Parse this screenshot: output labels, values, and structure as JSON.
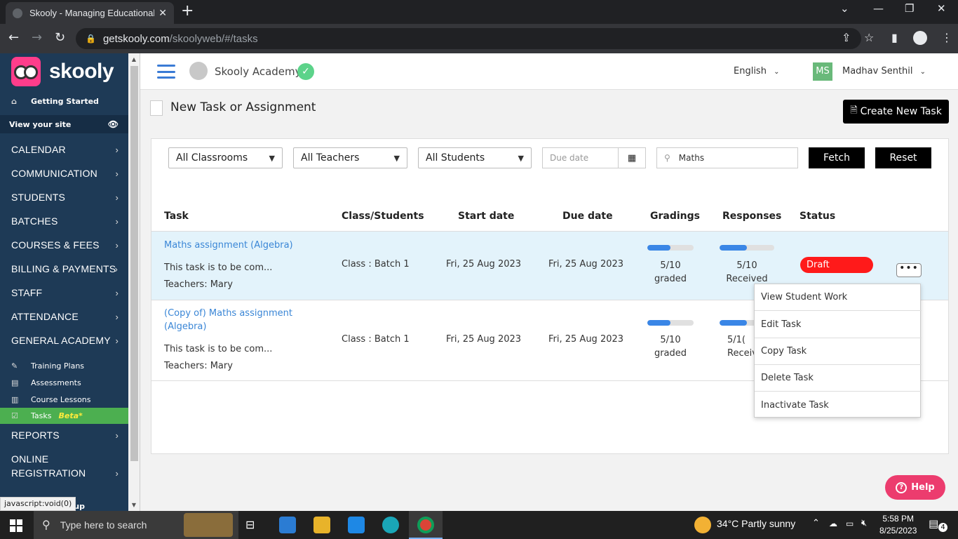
{
  "browser": {
    "tab_title": "Skooly - Managing Educational Ju",
    "url_domain": "getskooly.com",
    "url_path": "/skoolyweb/#/tasks"
  },
  "sidebar": {
    "brand": "skooly",
    "getting_started": "Getting Started",
    "view_site": "View your site",
    "menu": [
      "CALENDAR",
      "COMMUNICATION",
      "STUDENTS",
      "BATCHES",
      "COURSES & FEES",
      "BILLING & PAYMENTS",
      "STAFF",
      "ATTENDANCE",
      "GENERAL ACADEMY"
    ],
    "academy_items": [
      {
        "label": "Training Plans",
        "icon": "training-icon"
      },
      {
        "label": "Assessments",
        "icon": "assessment-icon"
      },
      {
        "label": "Course Lessons",
        "icon": "lessons-icon"
      },
      {
        "label": "Tasks",
        "icon": "tasks-icon",
        "badge": "Beta*"
      }
    ],
    "reports": "REPORTS",
    "online_registration_1": "ONLINE",
    "online_registration_2": "REGISTRATION",
    "status_text": "javascript:void(0)",
    "cut_text": "tup"
  },
  "header": {
    "school": "Skooly Academy",
    "language": "English",
    "user_initials": "MS",
    "user_name": "Madhav Senthil"
  },
  "page": {
    "title": "New Task or Assignment",
    "create_button": "Create New Task"
  },
  "filters": {
    "classrooms": "All Classrooms",
    "teachers": "All Teachers",
    "students": "All Students",
    "due_date_placeholder": "Due date",
    "search_value": "Maths",
    "fetch": "Fetch",
    "reset": "Reset"
  },
  "table": {
    "headers": [
      "Task",
      "Class/Students",
      "Start date",
      "Due date",
      "Gradings",
      "Responses",
      "Status"
    ],
    "rows": [
      {
        "title": "Maths assignment (Algebra)",
        "desc": "This task is to be com...",
        "teachers": "Teachers: Mary",
        "class": "Class : Batch 1",
        "start": "Fri, 25 Aug 2023",
        "due": "Fri, 25 Aug 2023",
        "graded": "5/10",
        "graded_label": "graded",
        "graded_fraction": 0.5,
        "received": "5/10",
        "received_label": "Received",
        "received_fraction": 0.5,
        "status": "Draft"
      },
      {
        "title_line1": "(Copy of) Maths assignment",
        "title_line2": "(Algebra)",
        "desc": "This task is to be com...",
        "teachers": "Teachers: Mary",
        "class": "Class : Batch 1",
        "start": "Fri, 25 Aug 2023",
        "due": "Fri, 25 Aug 2023",
        "graded": "5/10",
        "graded_label": "graded",
        "graded_fraction": 0.5,
        "received": "5/1(",
        "received_label": "Receiv",
        "received_fraction": 0.5
      }
    ]
  },
  "context_menu": [
    "View Student Work",
    "Edit Task",
    "Copy Task",
    "Delete Task",
    "Inactivate Task"
  ],
  "help": "Help",
  "taskbar": {
    "search_placeholder": "Type here to search",
    "weather": "34°C  Partly sunny",
    "time": "5:58 PM",
    "date": "8/25/2023",
    "notifications": "4"
  },
  "colors": {
    "sidebar": "#1e3a56",
    "accent": "#3a86d6",
    "draft": "#ff1a1a",
    "active_item": "#4caf50",
    "help": "#ec3c6e"
  }
}
